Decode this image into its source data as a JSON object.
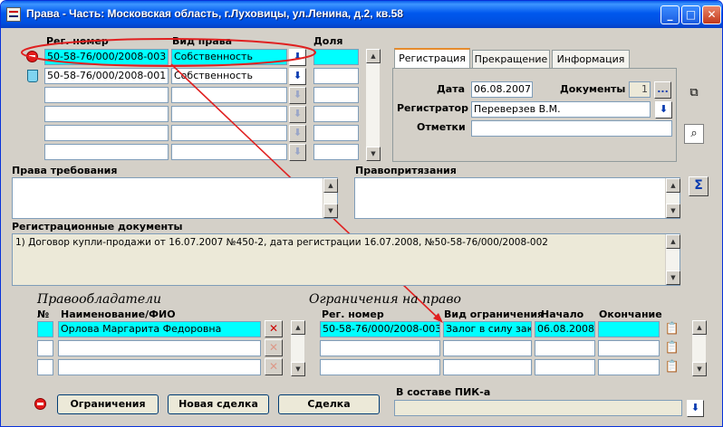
{
  "window": {
    "title": "Права - Часть: Московская область, г.Луховицы, ул.Ленина, д.2, кв.58",
    "minimize": "_",
    "maximize": "□",
    "close": "✕"
  },
  "rights_table": {
    "headers": {
      "reg_number": "Рег. номер",
      "right_type": "Вид права",
      "share": "Доля"
    },
    "rows": [
      {
        "reg_number": "50-58-76/000/2008-003",
        "right_type": "Собственность",
        "share": "",
        "selected": true,
        "status_icon": "no-entry-icon"
      },
      {
        "reg_number": "50-58-76/000/2008-001",
        "right_type": "Собственность",
        "share": "",
        "selected": false,
        "status_icon": "trash-icon"
      },
      {
        "reg_number": "",
        "right_type": "",
        "share": ""
      },
      {
        "reg_number": "",
        "right_type": "",
        "share": ""
      },
      {
        "reg_number": "",
        "right_type": "",
        "share": ""
      },
      {
        "reg_number": "",
        "right_type": "",
        "share": ""
      }
    ]
  },
  "tabs": [
    "Регистрация",
    "Прекращение",
    "Информация"
  ],
  "registration": {
    "date_label": "Дата",
    "date_value": "06.08.2007",
    "documents_label": "Документы",
    "documents_value": "1",
    "documents_button": "...",
    "registrar_label": "Регистратор",
    "registrar_value": "Переверзев В.М.",
    "notes_label": "Отметки",
    "notes_value": ""
  },
  "claims": {
    "rights_claims_label": "Права требования",
    "rights_claims_value": "",
    "legal_claims_label": "Правопритязания",
    "legal_claims_value": "",
    "sum_button": "Σ"
  },
  "reg_documents": {
    "label": "Регистрационные документы",
    "text": "1) Договор купли-продажи от 16.07.2007 №450-2, дата регистрации 16.07.2008, №50-58-76/000/2008-002"
  },
  "holders": {
    "header": "Правообладатели",
    "col_number": "№",
    "col_name": "Наименование/ФИО",
    "rows": [
      {
        "number": "",
        "name": "Орлова Маргарита Федоровна",
        "selected": true
      },
      {
        "number": "",
        "name": "",
        "selected": false
      },
      {
        "number": "",
        "name": "",
        "selected": false
      }
    ]
  },
  "restrictions": {
    "header": "Ограничения на право",
    "col_reg_number": "Рег. номер",
    "col_type": "Вид ограничения",
    "col_start": "Начало",
    "col_end": "Окончание",
    "rows": [
      {
        "reg_number": "50-58-76/000/2008-003",
        "type": "Залог в силу зако",
        "start": "06.08.2008",
        "end": "",
        "selected": true
      },
      {
        "reg_number": "",
        "type": "",
        "start": "",
        "end": "",
        "selected": false
      },
      {
        "reg_number": "",
        "type": "",
        "start": "",
        "end": "",
        "selected": false
      }
    ]
  },
  "bottom": {
    "restrictions_button": "Ограничения",
    "new_deal_button": "Новая сделка",
    "deal_button": "Сделка",
    "pik_label": "В составе ПИК-а",
    "pik_value": ""
  },
  "annotation_colors": {
    "highlight": "#E02020",
    "selection": "#00FFFF"
  }
}
